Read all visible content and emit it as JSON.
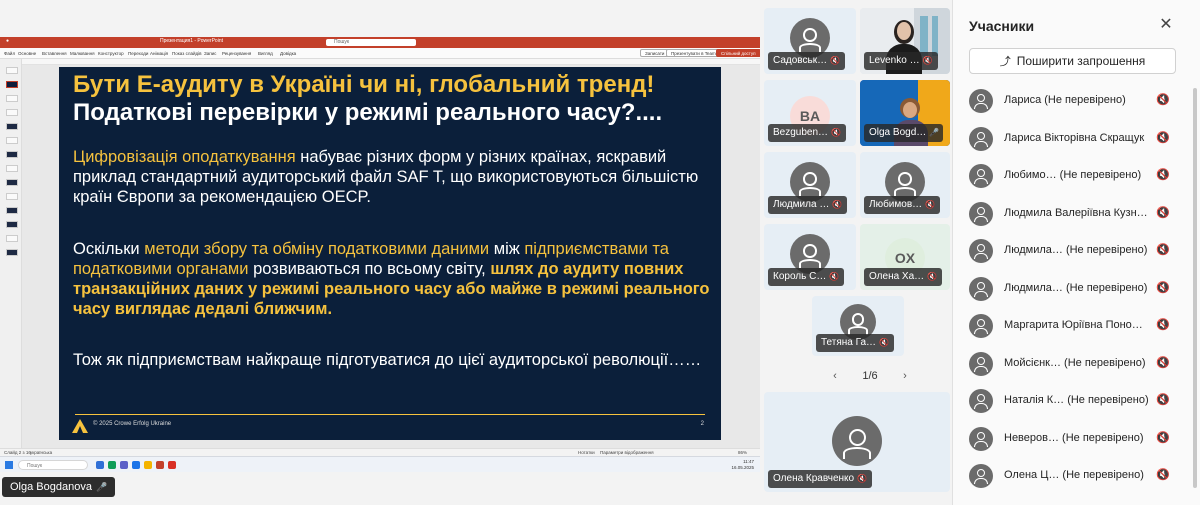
{
  "shared_screen": {
    "app_title": "Презентация1 - PowerPoint",
    "search_placeholder": "Пошук",
    "ribbon": [
      "Файл",
      "Основне",
      "Вставлення",
      "Малювання",
      "Конструктор",
      "Переходи",
      "Анімація",
      "Показ слайдів",
      "Запис",
      "Рецензування",
      "Вигляд",
      "Довідка"
    ],
    "ribbon_buttons": [
      "Записати",
      "Презентувати в Teams",
      "Спільний доступ"
    ],
    "status_left": "Слайд 2 з 16",
    "status_lang": "українська",
    "status_right": "Нотатки",
    "status_display": "Параметри відображення",
    "status_zoom": "86%",
    "taskbar_search": "Пошук",
    "clock_time": "11:47",
    "clock_date": "16.05.2025"
  },
  "slide": {
    "title_line1": "Бути Е-аудиту в Україні чи ні, глобальний тренд!",
    "title_line2": "Податкові перевірки у режимі реального часу?....",
    "p1_highlight": "Цифровізація оподаткування",
    "p1_text": " набуває різних форм у різних країнах, яскравий приклад стандартний аудиторський файл SAF T, що використовуються більшістю країн Європи за рекомендацією OECP.",
    "p2_a": "Оскільки ",
    "p2_b": "методи збору та обміну податковими даними",
    "p2_c": " між ",
    "p2_d": "підприємствами та податковими органами",
    "p2_e": " розвиваються по всьому світу, ",
    "p2_f": "шлях до аудиту повних транзакційних даних у режимі реального часу або майже в режимі реального часу виглядає дедалі ближчим.",
    "p3_text": "Тож як підприємствам найкраще підготуватися до цієї аудиторської революції……",
    "footer": "© 2025 Crowe Erfolg Ukraine",
    "page": "2"
  },
  "presenter": {
    "name": "Olga Bogdanova"
  },
  "tiles": [
    {
      "name": "Садовськ…",
      "type": "avatar"
    },
    {
      "name": "Levenko …",
      "type": "photo"
    },
    {
      "name": "Bezguben…",
      "type": "initials",
      "initials": "BA",
      "bg": "#f9dcd9"
    },
    {
      "name": "Olga Bogd…",
      "type": "photo2"
    },
    {
      "name": "Людмила …",
      "type": "avatar"
    },
    {
      "name": "Любимов…",
      "type": "avatar"
    },
    {
      "name": "Король С…",
      "type": "avatar"
    },
    {
      "name": "Олена Ха…",
      "type": "initials",
      "initials": "OX",
      "bg": "#dfeede"
    },
    {
      "name": "Тетяна Га…",
      "type": "avatar"
    },
    {
      "name": "Олена Кравченко",
      "type": "avatar"
    }
  ],
  "pager": {
    "label": "1/6"
  },
  "panel": {
    "title": "Учасники",
    "share_label": "Поширити запрошення",
    "participants": [
      "Лариса (Не перевірено)",
      "Лариса Вікторівна Скращук",
      "Любимо…   (Не перевірено)",
      "Людмила Валеріївна Кузн…",
      "Людмила…  (Не перевірено)",
      "Людмила…  (Не перевірено)",
      "Маргарита Юріївна Поно…",
      "Мойсієнк… (Не перевірено)",
      "Наталія К… (Не перевірено)",
      "Неверов…  (Не перевірено)",
      "Олена Ц…  (Не перевірено)"
    ]
  },
  "colors": {
    "slide_bg": "#0b1f3a",
    "accent_yellow": "#f6c23e",
    "ppt_red": "#c3402a",
    "teams_purple": "#5b5fc7"
  }
}
